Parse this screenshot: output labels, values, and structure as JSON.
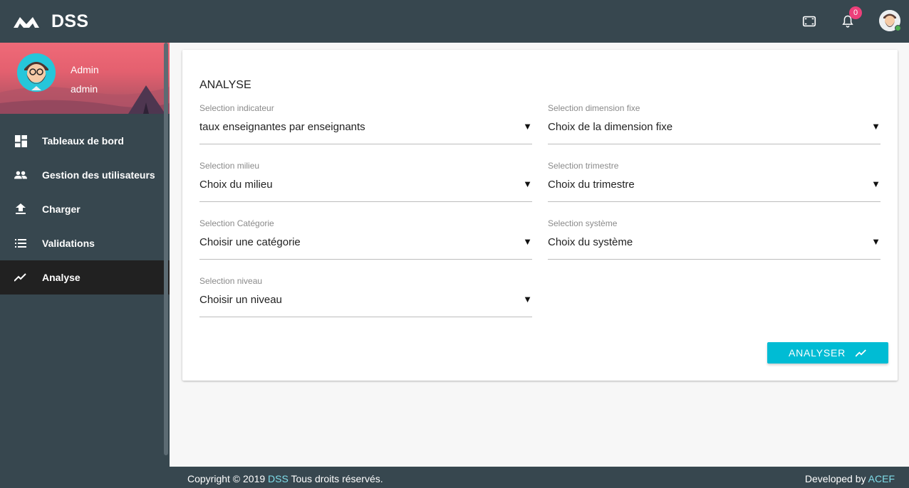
{
  "app": {
    "name": "DSS"
  },
  "header": {
    "notification_count": "0"
  },
  "profile": {
    "name": "Admin",
    "role": "admin"
  },
  "sidebar": {
    "items": [
      {
        "label": "Tableaux de bord",
        "icon": "dashboard-icon"
      },
      {
        "label": "Gestion des utilisateurs",
        "icon": "people-icon"
      },
      {
        "label": "Charger",
        "icon": "upload-icon"
      },
      {
        "label": "Validations",
        "icon": "list-icon"
      },
      {
        "label": "Analyse",
        "icon": "trending-up-icon",
        "active": true
      }
    ]
  },
  "main": {
    "title": "ANALYSE",
    "fields": {
      "indicateur": {
        "label": "Selection indicateur",
        "value": "taux enseignantes par enseignants"
      },
      "milieu": {
        "label": "Selection milieu",
        "value": "Choix du milieu"
      },
      "categorie": {
        "label": "Selection Catégorie",
        "value": "Choisir une catégorie"
      },
      "niveau": {
        "label": "Selection niveau",
        "value": "Choisir un niveau"
      },
      "dimension": {
        "label": "Selection dimension fixe",
        "value": "Choix de la dimension fixe"
      },
      "trimestre": {
        "label": "Selection trimestre",
        "value": "Choix du trimestre"
      },
      "systeme": {
        "label": "Selection système",
        "value": "Choix du système"
      }
    },
    "dropdown_arrow": "▼",
    "submit_label": "ANALYSER"
  },
  "footer": {
    "copyright_prefix": "Copyright © 2019",
    "copyright_brand": "DSS",
    "copyright_suffix": "Tous droits réservés.",
    "developed_prefix": "Developed by",
    "developed_by": "ACEF"
  },
  "colors": {
    "topbar": "#37474f",
    "sidebar": "#37474f",
    "active_item": "#212121",
    "accent": "#00bcd4",
    "badge": "#ec407a",
    "footer_link": "#80deea"
  }
}
